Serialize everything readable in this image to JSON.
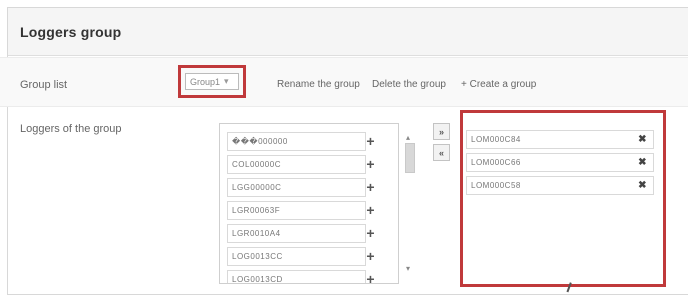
{
  "panel": {
    "title": "Loggers group"
  },
  "group_list": {
    "label": "Group list",
    "selected": "Group1",
    "rename_label": "Rename the group",
    "delete_label": "Delete the group",
    "create_label": "+ Create a group"
  },
  "loggers": {
    "label": "Loggers of the group",
    "available": [
      "���000000",
      "COL00000C",
      "LGG00000C",
      "LGR00063F",
      "LGR0010A4",
      "LOG0013CC",
      "LOG0013CD"
    ],
    "selected": [
      "LOM000C84",
      "LOM000C66",
      "LOM000C58"
    ]
  },
  "icons": {
    "add": "plus-icon",
    "remove": "close-icon",
    "move_all_right": "double-chevron-right-icon",
    "move_all_left": "double-chevron-left-icon",
    "dropdown": "chevron-down-icon"
  },
  "colors": {
    "highlight": "#c0393b"
  }
}
